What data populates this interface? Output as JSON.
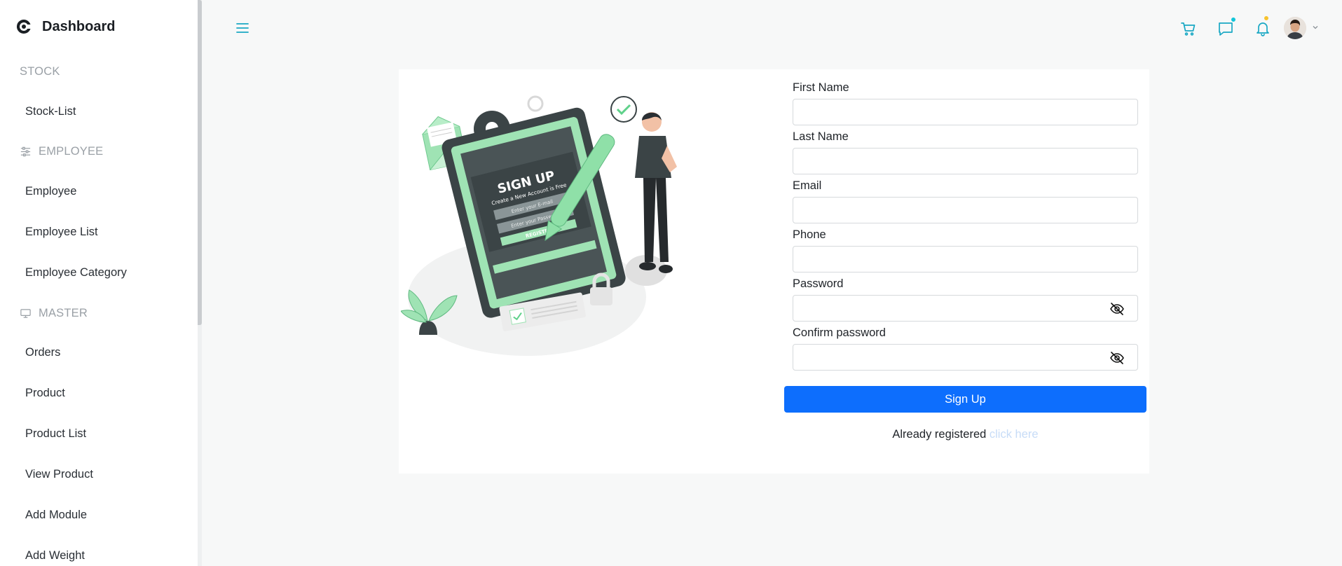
{
  "sidebar": {
    "brand": "Dashboard",
    "sections": [
      {
        "heading": "STOCK",
        "icon": "",
        "items": [
          "Stock-List"
        ]
      },
      {
        "heading": "EMPLOYEE",
        "icon": "sliders-icon",
        "items": [
          "Employee",
          "Employee List",
          "Employee Category"
        ]
      },
      {
        "heading": "MASTER",
        "icon": "monitor-icon",
        "items": [
          "Orders",
          "Product",
          "Product List",
          "View Product",
          "Add Module",
          "Add Weight"
        ]
      }
    ]
  },
  "header": {
    "icons": [
      "menu-icon",
      "cart-icon",
      "chat-icon",
      "bell-icon"
    ],
    "badge_colors": {
      "chat": "#11c5d9",
      "bell": "#f7c32e"
    },
    "accent": "#1aa8c4"
  },
  "form": {
    "fields": [
      {
        "label": "First Name",
        "value": ""
      },
      {
        "label": "Last Name",
        "value": ""
      },
      {
        "label": "Email",
        "value": ""
      },
      {
        "label": "Phone",
        "value": ""
      },
      {
        "label": "Password",
        "value": ""
      },
      {
        "label": "Confirm password",
        "value": ""
      }
    ],
    "submit_label": "Sign Up",
    "already_text": "Already registered",
    "link_text": "click here"
  },
  "illustration": {
    "heading": "SIGN UP",
    "subheading": "Create a New Account is Free",
    "email_placeholder": "Enter your E-mail",
    "password_placeholder": "Enter your Password",
    "button": "REGISTER"
  },
  "colors": {
    "primary": "#0d6efd",
    "illustration_green": "#8fe0a8",
    "illustration_dark": "#3b4446"
  }
}
